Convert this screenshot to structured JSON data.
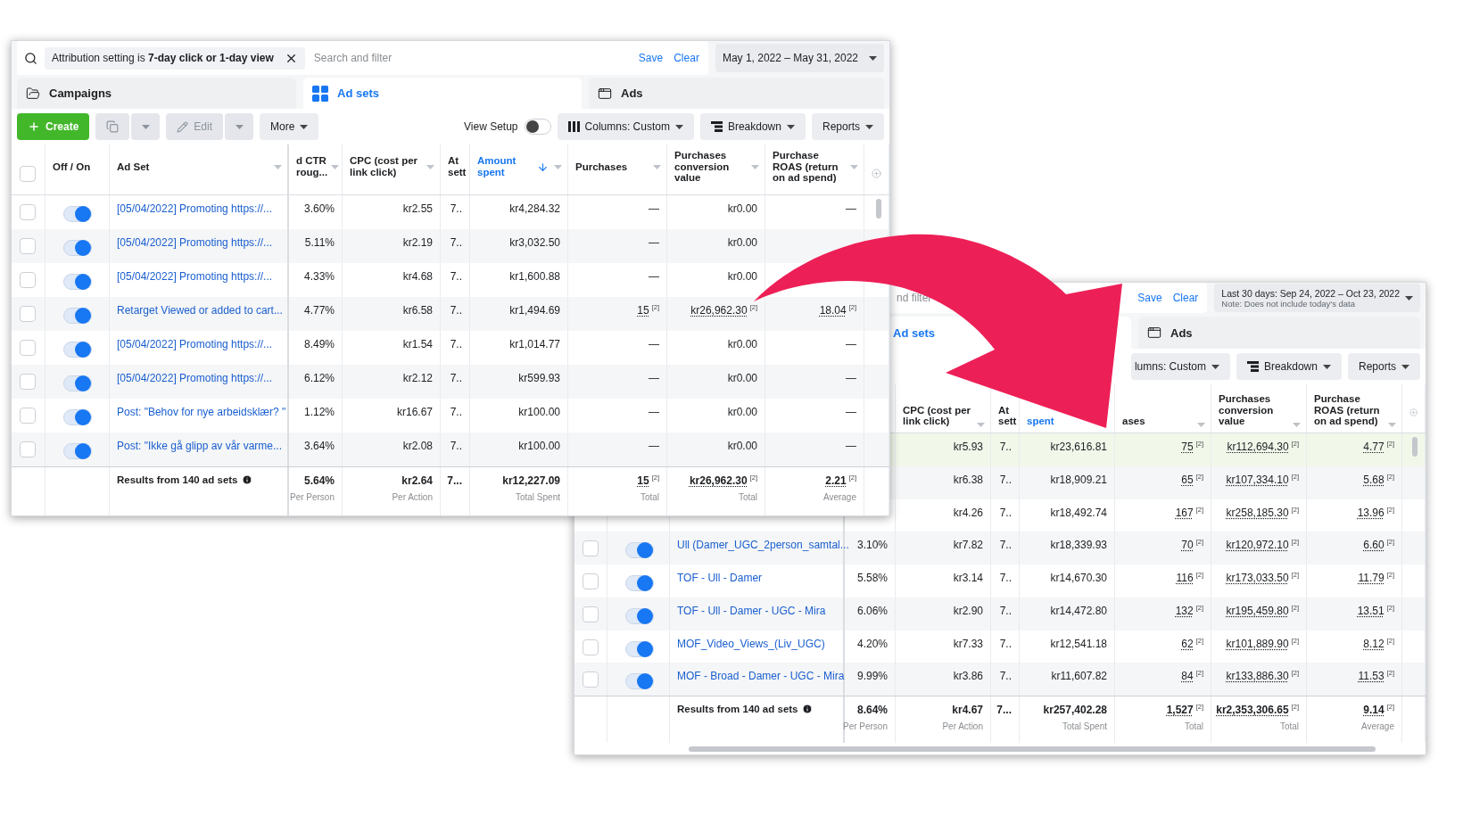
{
  "windows": [
    {
      "search": {
        "chip": "Attribution setting is **7-day click or 1-day view**",
        "placeholder": "Search and filter"
      },
      "save": "Save",
      "clear": "Clear",
      "date": {
        "label": "May 1, 2022 – May 31, 2022"
      },
      "tabs": [
        {
          "label": "Campaigns",
          "selected": false,
          "kind": "campaigns"
        },
        {
          "label": "Ad sets",
          "selected": true,
          "kind": "adsets"
        },
        {
          "label": "Ads",
          "selected": false,
          "kind": "ads"
        }
      ],
      "toolbar": {
        "left": [
          {
            "kind": "create",
            "label": "Create"
          },
          {
            "kind": "duplicate",
            "disabled": true
          },
          {
            "kind": "edit",
            "label": "Edit",
            "disabled": true
          },
          {
            "kind": "more",
            "label": "More"
          }
        ],
        "right": [
          {
            "kind": "view_setup",
            "label": "View Setup",
            "on": false
          },
          {
            "kind": "columns",
            "label": "Columns: Custom"
          },
          {
            "kind": "breakdown",
            "label": "Breakdown"
          },
          {
            "kind": "reports",
            "label": "Reports"
          }
        ]
      },
      "header_checkbox": {
        "checked": false
      },
      "toggle_column": {
        "label": "Off / On"
      },
      "name_column": {
        "label": "Ad Set",
        "menu": true
      },
      "columns": [
        {
          "label": "d CTR roug...",
          "menu": true,
          "sorted": false
        },
        {
          "label": "CPC (cost per link click)",
          "menu": true,
          "sorted": false
        },
        {
          "label": "At sett",
          "menu": false,
          "sorted": false
        },
        {
          "label": "Amount spent",
          "menu": true,
          "sorted": true
        },
        {
          "label": "Purchases",
          "menu": true,
          "sorted": false
        },
        {
          "label": "Purchases conversion value",
          "menu": true,
          "sorted": false
        },
        {
          "label": "Purchase ROAS (return on ad spend)",
          "menu": true,
          "sorted": false
        }
      ],
      "rows": [
        {
          "checked": false,
          "on": true,
          "name": "[05/04/2022] Promoting https://...",
          "cells": [
            "3.60%",
            "kr2.55",
            "7..",
            "kr4,284.32",
            "—",
            "kr0.00",
            "—"
          ]
        },
        {
          "checked": false,
          "on": true,
          "name": "[05/04/2022] Promoting https://...",
          "cells": [
            "5.11%",
            "kr2.19",
            "7..",
            "kr3,032.50",
            "—",
            "kr0.00",
            null
          ]
        },
        {
          "checked": false,
          "on": true,
          "name": "[05/04/2022] Promoting https://...",
          "cells": [
            "4.33%",
            "kr4.68",
            "7..",
            "kr1,600.88",
            "—",
            "kr0.00",
            null
          ]
        },
        {
          "checked": false,
          "on": true,
          "name": "Retarget Viewed or added to cart...",
          "cells": [
            "4.77%",
            "kr6.58",
            "7..",
            "kr1,494.69",
            {
              "value": "15",
              "note": "[2]"
            },
            {
              "value": "kr26,962.30",
              "note": "[2]"
            },
            {
              "value": "18.04",
              "note": "[2]"
            }
          ]
        },
        {
          "checked": false,
          "on": true,
          "name": "[05/04/2022] Promoting https://...",
          "cells": [
            "8.49%",
            "kr1.54",
            "7..",
            "kr1,014.77",
            "—",
            "kr0.00",
            "—"
          ]
        },
        {
          "checked": false,
          "on": true,
          "name": "[05/04/2022] Promoting https://...",
          "cells": [
            "6.12%",
            "kr2.12",
            "7..",
            "kr599.93",
            "—",
            "kr0.00",
            "—"
          ]
        },
        {
          "checked": false,
          "on": true,
          "name": "Post: \"Behov for nye arbeidsklær? \"",
          "cells": [
            "1.12%",
            "kr16.67",
            "7..",
            "kr100.00",
            "—",
            "kr0.00",
            "—"
          ]
        },
        {
          "checked": false,
          "on": true,
          "name": "Post: \"Ikke gå glipp av vår varme...",
          "cells": [
            "3.64%",
            "kr2.08",
            "7..",
            "kr100.00",
            "—",
            "kr0.00",
            "—"
          ]
        }
      ],
      "footer": {
        "label": "Results from 140 ad sets",
        "cells": [
          {
            "value": "5.64%",
            "sub": "Per Person"
          },
          {
            "value": "kr2.64",
            "sub": "Per Action"
          },
          {
            "value": "7..."
          },
          {
            "value": "kr12,227.09",
            "sub": "Total Spent"
          },
          {
            "value": "15",
            "note": "[2]",
            "sub": "Total"
          },
          {
            "value": "kr26,962.30",
            "note": "[2]",
            "sub": "Total"
          },
          {
            "value": "2.21",
            "note": "[2]",
            "sub": "Average"
          }
        ]
      }
    },
    {
      "search": {
        "placeholder": "nd filter"
      },
      "save": "Save",
      "clear": "Clear",
      "date": {
        "label": "Last 30 days: Sep 24, 2022 – Oct 23, 2022",
        "note": "Note: Does not include today's data"
      },
      "tabs": [
        {
          "label": "Ad sets",
          "selected": true
        },
        {
          "label": "Ads",
          "selected": false,
          "kind": "ads"
        }
      ],
      "toolbar": {
        "right": [
          {
            "kind": "columns",
            "label": "lumns: Custom"
          },
          {
            "kind": "breakdown",
            "label": "Breakdown"
          },
          {
            "kind": "reports",
            "label": "Reports"
          }
        ]
      },
      "columns": [
        null,
        {
          "label": "CPC (cost per link click)",
          "menu": true,
          "sorted": false
        },
        {
          "label": "At sett",
          "menu": false,
          "sorted": false
        },
        {
          "label": "spent",
          "menu": false,
          "sorted": true
        },
        {
          "label": "ases",
          "menu": true,
          "sorted": false
        },
        {
          "label": "Purchases conversion value",
          "menu": true,
          "sorted": false
        },
        {
          "label": "Purchase ROAS (return on ad spend)",
          "menu": true,
          "sorted": false
        }
      ],
      "rows": [
        {
          "highlighted": true,
          "cells": [
            null,
            "kr5.93",
            "7..",
            "kr23,616.81",
            {
              "value": "75",
              "note": "[2]"
            },
            {
              "value": "kr112,694.30",
              "note": "[2]"
            },
            {
              "value": "4.77",
              "note": "[2]"
            }
          ]
        },
        {
          "highlighted": false,
          "cells": [
            null,
            "kr6.38",
            "7..",
            "kr18,909.21",
            {
              "value": "65",
              "note": "[2]"
            },
            {
              "value": "kr107,334.10",
              "note": "[2]"
            },
            {
              "value": "5.68",
              "note": "[2]"
            }
          ]
        },
        {
          "highlighted": false,
          "cells": [
            null,
            "kr4.26",
            "7..",
            "kr18,492.74",
            {
              "value": "167",
              "note": "[2]"
            },
            {
              "value": "kr258,185.30",
              "note": "[2]"
            },
            {
              "value": "13.96",
              "note": "[2]"
            }
          ]
        },
        {
          "highlighted": false,
          "checked": false,
          "on": true,
          "name": "Ull (Damer_UGC_2person_samtal...",
          "cells": [
            "3.10%",
            "kr7.82",
            "7..",
            "kr18,339.93",
            {
              "value": "70",
              "note": "[2]"
            },
            {
              "value": "kr120,972.10",
              "note": "[2]"
            },
            {
              "value": "6.60",
              "note": "[2]"
            }
          ]
        },
        {
          "highlighted": false,
          "checked": false,
          "on": true,
          "name": "TOF - Ull - Damer",
          "cells": [
            "5.58%",
            "kr3.14",
            "7..",
            "kr14,670.30",
            {
              "value": "116",
              "note": "[2]"
            },
            {
              "value": "kr173,033.50",
              "note": "[2]"
            },
            {
              "value": "11.79",
              "note": "[2]"
            }
          ]
        },
        {
          "highlighted": false,
          "checked": false,
          "on": true,
          "name": "TOF - Ull - Damer - UGC - Mira",
          "cells": [
            "6.06%",
            "kr2.90",
            "7..",
            "kr14,472.80",
            {
              "value": "132",
              "note": "[2]"
            },
            {
              "value": "kr195,459.80",
              "note": "[2]"
            },
            {
              "value": "13.51",
              "note": "[2]"
            }
          ]
        },
        {
          "highlighted": false,
          "checked": false,
          "on": true,
          "name": "MOF_Video_Views_(Liv_UGC)",
          "cells": [
            "4.20%",
            "kr7.33",
            "7..",
            "kr12,541.18",
            {
              "value": "62",
              "note": "[2]"
            },
            {
              "value": "kr101,889.90",
              "note": "[2]"
            },
            {
              "value": "8.12",
              "note": "[2]"
            }
          ]
        },
        {
          "highlighted": false,
          "checked": false,
          "on": true,
          "name": "MOF - Broad - Damer - UGC - Mira",
          "cells": [
            "9.99%",
            "kr3.86",
            "7..",
            "kr11,607.82",
            {
              "value": "84",
              "note": "[2]"
            },
            {
              "value": "kr133,886.30",
              "note": "[2]"
            },
            {
              "value": "11.53",
              "note": "[2]"
            }
          ]
        }
      ],
      "footer": {
        "label": "Results from 140 ad sets",
        "cells": [
          {
            "value": "8.64%",
            "sub": "Per Person"
          },
          {
            "value": "kr4.67",
            "sub": "Per Action"
          },
          {
            "value": "7..."
          },
          {
            "value": "kr257,402.28",
            "sub": "Total Spent"
          },
          {
            "value": "1,527",
            "note": "[2]",
            "sub": "Total"
          },
          {
            "value": "kr2,353,306.65",
            "note": "[2]",
            "sub": "Total"
          },
          {
            "value": "9.14",
            "note": "[2]",
            "sub": "Average"
          }
        ]
      }
    }
  ]
}
